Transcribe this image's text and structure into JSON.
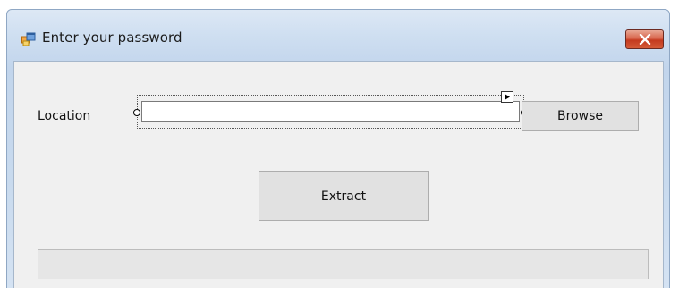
{
  "window": {
    "title": "Enter your password"
  },
  "form": {
    "location_label": "Location",
    "location_value": "",
    "browse_label": "Browse",
    "extract_label": "Extract"
  },
  "progress": {
    "fraction": 0
  },
  "icons": {
    "app": "app-window-icon",
    "close": "close-icon",
    "smart_tag": "smart-tag-arrow-icon"
  },
  "colors": {
    "title_gradient_top": "#dde8f5",
    "client_background": "#f0f0f0",
    "close_button": "#c43a1f",
    "button_face": "#e1e1e1"
  }
}
